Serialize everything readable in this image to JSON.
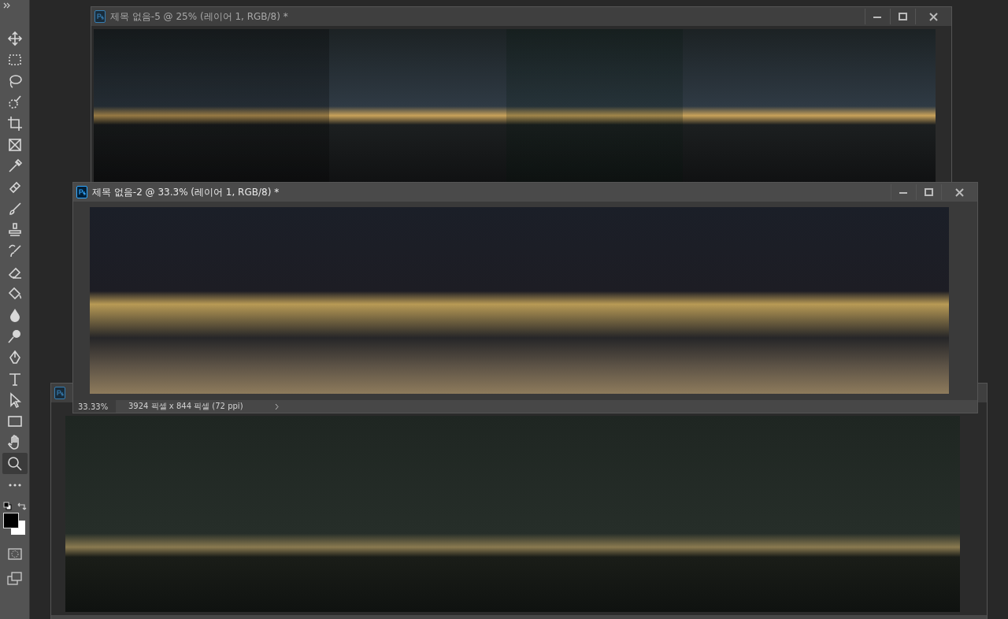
{
  "toolbar": {
    "tools": [
      {
        "kind": "move",
        "selected": false
      },
      {
        "kind": "marquee",
        "selected": false
      },
      {
        "kind": "lasso",
        "selected": false
      },
      {
        "kind": "quick-select",
        "selected": false
      },
      {
        "kind": "crop",
        "selected": false
      },
      {
        "kind": "frame",
        "selected": false
      },
      {
        "kind": "eyedropper",
        "selected": false
      },
      {
        "kind": "bandage",
        "selected": false
      },
      {
        "kind": "brush",
        "selected": false
      },
      {
        "kind": "stamp",
        "selected": false
      },
      {
        "kind": "history-brush",
        "selected": false
      },
      {
        "kind": "eraser",
        "selected": false
      },
      {
        "kind": "bucket",
        "selected": false
      },
      {
        "kind": "drop",
        "selected": false
      },
      {
        "kind": "dodge",
        "selected": false
      },
      {
        "kind": "pen",
        "selected": false
      },
      {
        "kind": "type",
        "selected": false
      },
      {
        "kind": "pointer",
        "selected": false
      },
      {
        "kind": "rectangle",
        "selected": false
      },
      {
        "kind": "hand",
        "selected": false
      },
      {
        "kind": "zoom",
        "selected": true
      },
      {
        "kind": "more",
        "selected": false
      }
    ]
  },
  "documents": [
    {
      "active": false
    },
    {
      "title": "제목 없음-5 @ 25% (레이어 1, RGB/8) *",
      "active": false
    },
    {
      "title": "제목 없음-2 @ 33.3% (레이어 1, RGB/8) *",
      "active": true,
      "zoom": "33.33%",
      "info": "3924 픽셀 x 844 픽셀 (72 ppi)"
    }
  ]
}
